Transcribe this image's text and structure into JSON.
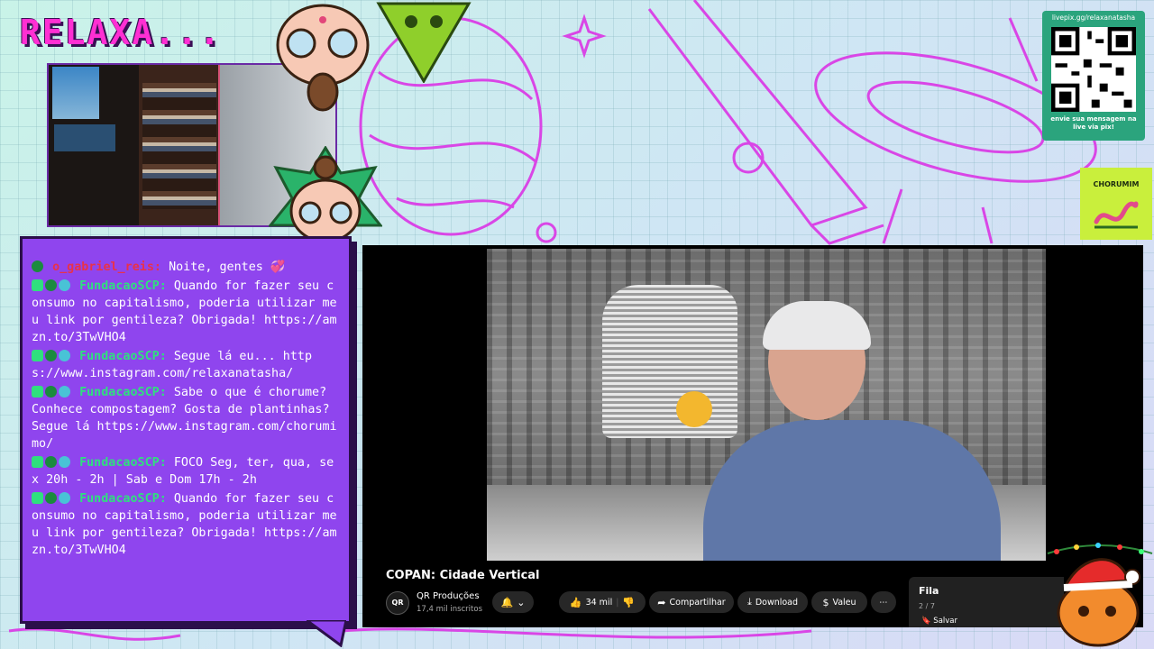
{
  "overlay": {
    "logo_text": "RELAXA...",
    "qr": {
      "url": "livepix.gg/relaxanatasha",
      "message": "envie sua mensagem na live via pix!"
    },
    "sponsor": {
      "name": "CHORUMIM"
    }
  },
  "chat": {
    "messages": [
      {
        "user": "o_gabriel_reis:",
        "user_color": "#e8324a",
        "text": "Noite, gentes 💞",
        "badges": [
          "green-alien-icon"
        ]
      },
      {
        "user": "FundacaoSCP:",
        "user_color": "#2fe07e",
        "text": "Quando for fazer seu consumo no capitalismo, poderia utilizar meu link por gentileza? Obrigada! https://amzn.to/3TwVHO4",
        "badges": [
          "sword-icon",
          "green-alien-icon",
          "robot-icon"
        ]
      },
      {
        "user": "FundacaoSCP:",
        "user_color": "#2fe07e",
        "text": "Segue lá eu... https://www.instagram.com/relaxanatasha/",
        "badges": [
          "sword-icon",
          "green-alien-icon",
          "robot-icon"
        ]
      },
      {
        "user": "FundacaoSCP:",
        "user_color": "#2fe07e",
        "text": "Sabe o que é chorume? Conhece compostagem? Gosta de plantinhas? Segue lá https://www.instagram.com/chorumimo/",
        "badges": [
          "sword-icon",
          "green-alien-icon",
          "robot-icon"
        ]
      },
      {
        "user": "FundacaoSCP:",
        "user_color": "#2fe07e",
        "text": "FOCO Seg, ter, qua, sex 20h - 2h | Sab e Dom 17h - 2h",
        "badges": [
          "sword-icon",
          "green-alien-icon",
          "robot-icon"
        ]
      },
      {
        "user": "FundacaoSCP:",
        "user_color": "#2fe07e",
        "text": "Quando for fazer seu consumo no capitalismo, poderia utilizar meu link por gentileza? Obrigada! https://amzn.to/3TwVHO4",
        "badges": [
          "sword-icon",
          "green-alien-icon",
          "robot-icon"
        ]
      }
    ]
  },
  "youtube": {
    "video_title": "COPAN: Cidade Vertical",
    "channel": {
      "avatar_text": "QR",
      "name": "QR Produções",
      "subscribers": "17,4 mil inscritos"
    },
    "actions": {
      "like_count": "34 mil",
      "share_label": "Compartilhar",
      "download_label": "Download",
      "thanks_label": "Valeu",
      "more_label": "⋯"
    },
    "queue": {
      "title": "Fila",
      "count": "2 / 7",
      "save_label": "Salvar"
    }
  },
  "colors": {
    "chat_bg": "#8f45ee",
    "logo": "#ff2fd3",
    "accent_green": "#2fe07e",
    "qr_bg": "#2ba47d"
  }
}
